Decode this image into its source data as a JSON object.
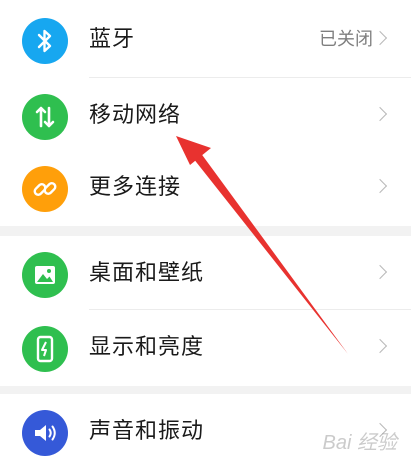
{
  "colors": {
    "bluetooth": "#17a7f0",
    "mobile_network": "#2fbf4f",
    "more_connections": "#ff9f0a",
    "desktop_wallpaper": "#2fbf4f",
    "display_brightness": "#2fbf4f",
    "sound_vibration": "#3559d8",
    "annotation_arrow": "#e8322f"
  },
  "settings": {
    "items": [
      {
        "label": "蓝牙",
        "value": "已关闭",
        "icon": "bluetooth-icon"
      },
      {
        "label": "移动网络",
        "value": "",
        "icon": "mobile-network-icon"
      },
      {
        "label": "更多连接",
        "value": "",
        "icon": "link-icon"
      },
      {
        "label": "桌面和壁纸",
        "value": "",
        "icon": "wallpaper-icon"
      },
      {
        "label": "显示和亮度",
        "value": "",
        "icon": "display-icon"
      },
      {
        "label": "声音和振动",
        "value": "",
        "icon": "speaker-icon"
      }
    ]
  },
  "watermark": {
    "text": "Bai 经验"
  }
}
